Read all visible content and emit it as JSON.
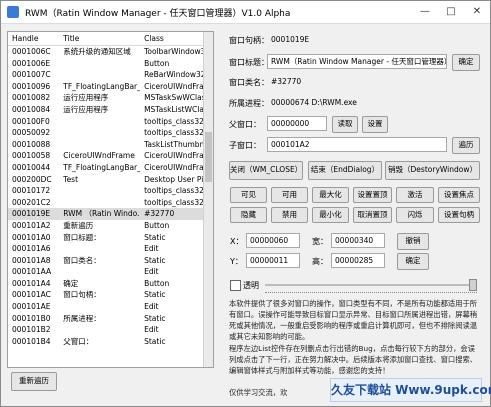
{
  "window": {
    "title": "RWM（Ratin Window Manager - 任天窗口管理器）V1.0 Alpha"
  },
  "list": {
    "columns": [
      "Handle",
      "Title",
      "Class"
    ],
    "rows": [
      [
        "0001006C",
        "系统升级的通知区域",
        "ToolbarWindow3"
      ],
      [
        "0001006E",
        "",
        "Button"
      ],
      [
        "0001007C",
        "",
        "ReBarWindow32"
      ],
      [
        "00010096",
        "TF_FloatingLangBar_...",
        "CiceroUIWndFra"
      ],
      [
        "00010082",
        "运行应用程序",
        "MSTaskSwWClas"
      ],
      [
        "00010084",
        "运行应用程序",
        "MSTaskListWCla"
      ],
      [
        "000100F0",
        "",
        "tooltips_class32"
      ],
      [
        "00050092",
        "",
        "tooltips_class32"
      ],
      [
        "00010088",
        "",
        "TaskListThumbna"
      ],
      [
        "00010058",
        "CiceroUIWndFrame",
        "CiceroUIWndFra"
      ],
      [
        "00010044",
        "TF_FloatingLangBar_...",
        "CiceroUIWndFra"
      ],
      [
        "000200DC",
        "Test",
        "Desktop User Pic"
      ],
      [
        "00010172",
        "",
        "tooltips_class32"
      ],
      [
        "000201C2",
        "",
        "tooltips_class32"
      ],
      [
        "0001019E",
        "RWM （Ratin Windo...",
        "#32770"
      ],
      [
        "000101A2",
        "重新遍历",
        "Button"
      ],
      [
        "000101A0",
        "窗口标题：",
        "Static"
      ],
      [
        "000101A6",
        "",
        "Edit"
      ],
      [
        "000101A8",
        "窗口类名：",
        "Static"
      ],
      [
        "000101AA",
        "",
        "Edit"
      ],
      [
        "000101A4",
        "确定",
        "Button"
      ],
      [
        "000101AC",
        "窗口句柄：",
        "Static"
      ],
      [
        "000101AE",
        "",
        "Edit"
      ],
      [
        "000101B0",
        "所属进程：",
        "Static"
      ],
      [
        "000101B2",
        "",
        "Edit"
      ],
      [
        "000101B4",
        "父窗口：",
        "Static"
      ]
    ],
    "selected_index": 14
  },
  "buttons": {
    "rescan": "重新遍历",
    "confirm": "确定",
    "read": "读取",
    "set": "设置",
    "traverse": "遍历",
    "revoke": "撤销",
    "confirm2": "确定"
  },
  "fields": {
    "handle_label": "窗口句柄：",
    "handle_value": "0001019E",
    "title_label": "窗口标题：",
    "title_value": "RWM（Ratin Window Manager - 任天窗口管理器）",
    "class_label": "窗口类名：",
    "class_value": "#32770",
    "process_label": "所属进程：",
    "process_value": "00000674 D:\\RWM.exe",
    "parent_label": "父窗口：",
    "parent_value": "00000000",
    "child_label": "子窗口：",
    "child_value": "000101A2"
  },
  "actions": {
    "close": "关闭（WM_CLOSE）",
    "end_dialog": "结束（EndDialog）",
    "destroy": "销毁（DestoryWindow）"
  },
  "grid": [
    [
      "可见",
      "可用",
      "最大化",
      "设置置顶",
      "激活",
      "设置焦点"
    ],
    [
      "隐藏",
      "禁用",
      "最小化",
      "取消置顶",
      "闪烁",
      "设置句柄"
    ]
  ],
  "coords": {
    "x_label": "X：",
    "x_value": "00000060",
    "w_label": "宽：",
    "w_value": "00000340",
    "y_label": "Y：",
    "y_value": "00000011",
    "h_label": "高：",
    "h_value": "00000285"
  },
  "transparent_label": "透明",
  "transparency": 1.0,
  "info": {
    "p1": "本软件提供了很多对窗口的操作，窗口类型有不同，不是所有功能都适用于所有窗口。误操作可能导致目标窗口显示异常、目标窗口所属进程出错，屏幕稍死或其他情况，一般重启受影响的程序或重启计算机即可，但也不排除阅读温或其它未知影响的可能。",
    "p2": "程序左边List控件存在列删点击行出错的Bug，点击每行较下方的部分，会误列成点击了下一行，正在努力解决中。后续版本将添加窗口查找、窗口搜索、编辑窗体样式与附加样式等功能，感谢您的支持！",
    "p3": "仅供学习交流，欢"
  },
  "watermark": "久友下载站 Www.9upk.com"
}
